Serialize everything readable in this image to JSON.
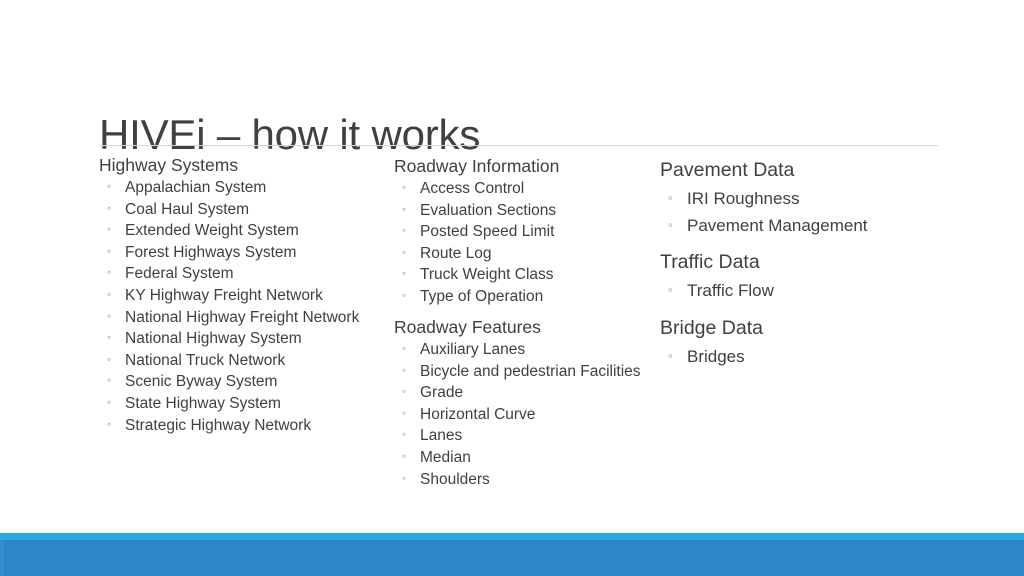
{
  "slide": {
    "title": "HIVEi – how it works",
    "bullet_glyph": "◦",
    "colors": {
      "text": "#404040",
      "bullet": "#5B9BD5",
      "rule": "#D4D4D4",
      "band_light": "#29ABE2",
      "band_main": "#2E86C8",
      "background": "#FFFFFF"
    }
  },
  "columns": {
    "column1": {
      "groups": [
        {
          "title": "Highway Systems",
          "items": [
            "Appalachian System",
            "Coal Haul System",
            "Extended Weight System",
            "Forest Highways System",
            "Federal System",
            "KY Highway Freight Network",
            "National Highway Freight Network",
            "National Highway System",
            "National Truck Network",
            "Scenic Byway System",
            "State Highway System",
            "Strategic Highway Network"
          ]
        }
      ]
    },
    "column2": {
      "groups": [
        {
          "title": "Roadway Information",
          "items": [
            "Access Control",
            "Evaluation Sections",
            "Posted Speed Limit",
            "Route Log",
            "Truck Weight Class",
            "Type of Operation"
          ]
        },
        {
          "title": "Roadway Features",
          "items": [
            "Auxiliary Lanes",
            "Bicycle and pedestrian Facilities",
            "Grade",
            "Horizontal Curve",
            "Lanes",
            "Median",
            "Shoulders"
          ]
        }
      ]
    },
    "column3": {
      "groups": [
        {
          "title": "Pavement Data",
          "items": [
            "IRI Roughness",
            "Pavement Management"
          ]
        },
        {
          "title": "Traffic Data",
          "items": [
            "Traffic Flow"
          ]
        },
        {
          "title": "Bridge Data",
          "items": [
            "Bridges"
          ]
        }
      ]
    }
  }
}
